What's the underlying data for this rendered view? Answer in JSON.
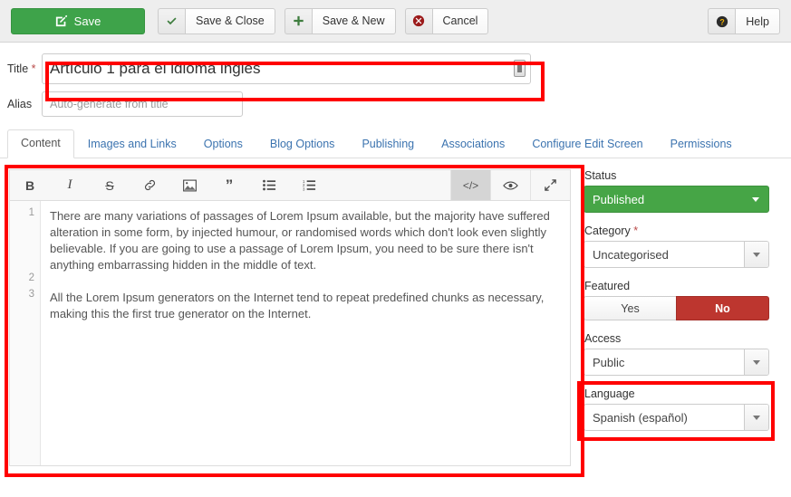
{
  "toolbar": {
    "save_label": "Save",
    "save_icon": "edit-square-icon",
    "save_close_label": "Save & Close",
    "save_close_icon": "check-icon",
    "save_new_label": "Save & New",
    "save_new_icon": "plus-icon",
    "cancel_label": "Cancel",
    "cancel_icon": "circle-x-icon",
    "help_label": "Help",
    "help_icon": "question-circle-icon"
  },
  "form": {
    "title_label": "Title",
    "title_required": "*",
    "title_value": "Artículo 1 para el idioma inglés",
    "title_autofill_icon": "autofill-icon",
    "alias_label": "Alias",
    "alias_value": "",
    "alias_placeholder": "Auto-generate from title"
  },
  "tabs": [
    {
      "label": "Content",
      "active": true
    },
    {
      "label": "Images and Links",
      "active": false
    },
    {
      "label": "Options",
      "active": false
    },
    {
      "label": "Blog Options",
      "active": false
    },
    {
      "label": "Publishing",
      "active": false
    },
    {
      "label": "Associations",
      "active": false
    },
    {
      "label": "Configure Edit Screen",
      "active": false
    },
    {
      "label": "Permissions",
      "active": false
    }
  ],
  "editor": {
    "toolbar_buttons": [
      {
        "name": "bold-icon",
        "glyph": "B"
      },
      {
        "name": "italic-icon",
        "glyph": "I"
      },
      {
        "name": "strikethrough-icon",
        "glyph": "S"
      },
      {
        "name": "link-icon",
        "glyph": "🔗"
      },
      {
        "name": "image-icon",
        "glyph": "Ὓc"
      },
      {
        "name": "quote-icon",
        "glyph": "”"
      },
      {
        "name": "unordered-list-icon",
        "glyph": "☰"
      },
      {
        "name": "ordered-list-icon",
        "glyph": "☰"
      }
    ],
    "right_buttons": [
      {
        "name": "code-view-icon",
        "glyph": "</>",
        "active": true
      },
      {
        "name": "preview-eye-icon",
        "glyph": "◉",
        "active": false
      },
      {
        "name": "fullscreen-icon",
        "glyph": "⤢",
        "active": false
      }
    ],
    "line_numbers": [
      "1",
      "2",
      "3"
    ],
    "paragraph_1": "There are many variations of passages of Lorem Ipsum available, but the majority have suffered alteration in some form, by injected humour, or randomised words which don't look even slightly believable. If you are going to use a passage of Lorem Ipsum, you need to be sure there isn't anything embarrassing hidden in the middle of text.",
    "paragraph_2": "All the Lorem Ipsum generators on the Internet tend to repeat predefined chunks as necessary, making this the first true generator on the Internet."
  },
  "sidebar": {
    "status_label": "Status",
    "status_value": "Published",
    "category_label": "Category",
    "category_required": "*",
    "category_value": "Uncategorised",
    "featured_label": "Featured",
    "featured_yes": "Yes",
    "featured_no": "No",
    "access_label": "Access",
    "access_value": "Public",
    "language_label": "Language",
    "language_value": "Spanish (español)"
  },
  "colors": {
    "save_green": "#3ea34a",
    "status_green": "#46a546",
    "no_red": "#bd362f",
    "highlight_red": "#ff0000",
    "tab_link_blue": "#3b73af"
  }
}
